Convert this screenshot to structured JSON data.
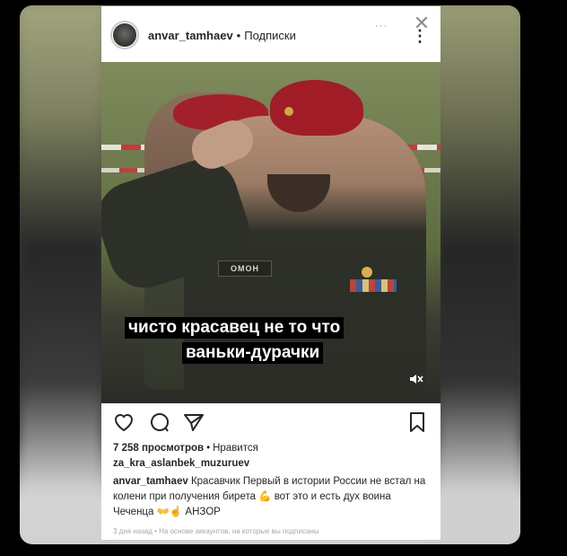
{
  "header": {
    "username": "anvar_tamhaev",
    "separator": "•",
    "follow_label": "Подписки",
    "more_glyph": "⋮",
    "close_glyph": "✕",
    "ellipsis": "···"
  },
  "photo": {
    "patch_text": "ОМОН",
    "overlay_line1": "чисто красавец не то что",
    "overlay_line2": "ваньки-дурачки",
    "mute_icon": "speaker-muted-icon"
  },
  "actions": {
    "icons": [
      "heart-icon",
      "comment-icon",
      "share-icon",
      "bookmark-icon"
    ]
  },
  "stats": {
    "views": "7 258 просмотров",
    "separator": "•",
    "likes_label": "Нравится",
    "liked_by": "za_kra_aslanbek_muzuruev"
  },
  "caption": {
    "username": "anvar_tamhaev",
    "text": "Красавчик Первый в истории России не встал на колени при получения бирета 💪 вот это и есть дух воина Чеченца 👐☝ АНЗОР"
  },
  "meta": {
    "text": "3 дня назад • На основе аккаунтов, на которые вы подписаны"
  }
}
